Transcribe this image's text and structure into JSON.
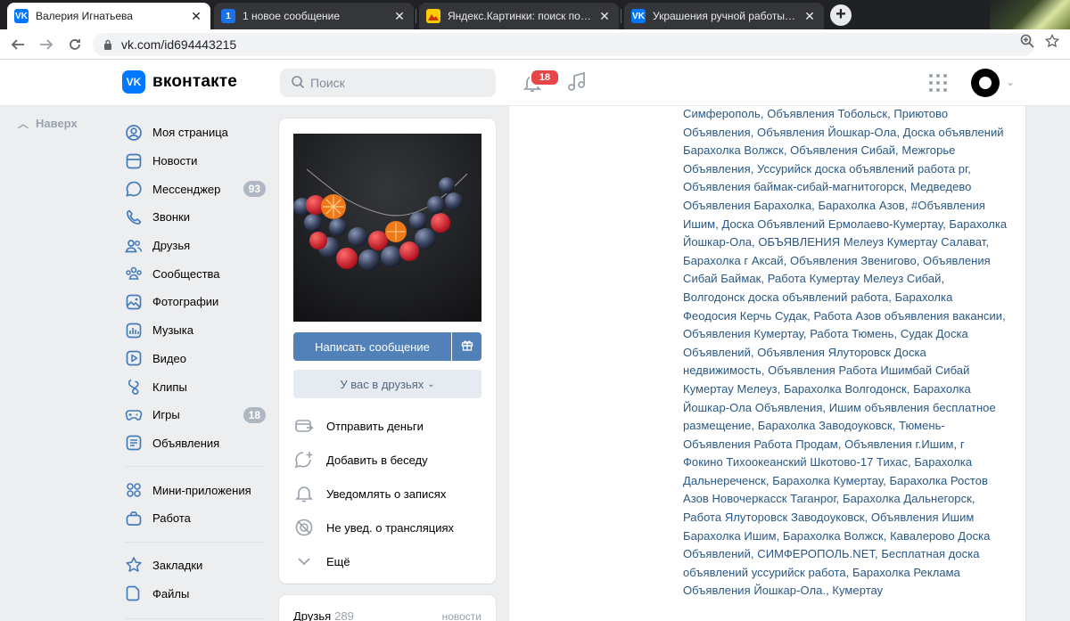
{
  "browser": {
    "tabs": [
      {
        "title": "Валерия Игнатьева",
        "favicon": "vk-icon",
        "active": true
      },
      {
        "title": "1 новое сообщение",
        "favicon": "notification-1-icon",
        "active": false
      },
      {
        "title": "Яндекс.Картинки: поиск по изоб",
        "favicon": "yandex-images-icon",
        "active": false
      },
      {
        "title": "Украшения ручной работы от п",
        "favicon": "vk-icon",
        "active": false
      }
    ],
    "url": "vk.com/id694443215"
  },
  "header": {
    "logo_text": "вконтакте",
    "search_placeholder": "Поиск",
    "notifications_count": "18"
  },
  "nav": {
    "up_label": "Наверх",
    "items": [
      {
        "label": "Моя страница",
        "icon": "user-circle-icon"
      },
      {
        "label": "Новости",
        "icon": "newsfeed-icon"
      },
      {
        "label": "Мессенджер",
        "icon": "message-icon",
        "count": "93"
      },
      {
        "label": "Звонки",
        "icon": "phone-icon"
      },
      {
        "label": "Друзья",
        "icon": "users-icon"
      },
      {
        "label": "Сообщества",
        "icon": "communities-icon"
      },
      {
        "label": "Фотографии",
        "icon": "photo-icon"
      },
      {
        "label": "Музыка",
        "icon": "music-icon"
      },
      {
        "label": "Видео",
        "icon": "video-icon"
      },
      {
        "label": "Клипы",
        "icon": "clips-icon"
      },
      {
        "label": "Игры",
        "icon": "gamepad-icon",
        "count": "18"
      },
      {
        "label": "Объявления",
        "icon": "classifieds-icon"
      }
    ],
    "items2": [
      {
        "label": "Мини-приложения",
        "icon": "apps-icon"
      },
      {
        "label": "Работа",
        "icon": "briefcase-icon"
      }
    ],
    "items3": [
      {
        "label": "Закладки",
        "icon": "star-icon"
      },
      {
        "label": "Файлы",
        "icon": "file-icon"
      }
    ]
  },
  "profile": {
    "write_message": "Написать сообщение",
    "friends_status": "У вас в друзьях",
    "actions": [
      {
        "label": "Отправить деньги",
        "icon": "money-transfer-icon"
      },
      {
        "label": "Добавить в беседу",
        "icon": "add-chat-icon"
      },
      {
        "label": "Уведомлять о записях",
        "icon": "bell-icon"
      },
      {
        "label": "Не увед. о трансляциях",
        "icon": "no-broadcast-icon"
      },
      {
        "label": "Ещё",
        "icon": "chevron-down-icon"
      }
    ],
    "friends_block": {
      "title": "Друзья",
      "count": "289",
      "link": "новости"
    }
  },
  "ads_links": [
    "Симферополь",
    "Объявления Тобольск",
    "Приютово Объявления",
    "Объявления Йошкар-Ола",
    "Доска объявлений Барахолка Волжск",
    "Объявления Сибай",
    "Межгорье Объявления",
    "Уссурийск доска объявлений работа рг",
    "Объявления баймак-сибай-магнитогорск",
    "Медведево Объявления Барахолка",
    "Барахолка Азов",
    "#Объявления Ишим",
    "Доска Объявлений Ермолаево-Кумертау",
    "Барахолка Йошкар-Ола",
    "ОБЪЯВЛЕНИЯ Мелеуз Кумертау Салават",
    "Барахолка г Аксай",
    "Объявления Звенигово",
    "Объявления Сибай Баймак",
    "Работа Кумертау Мелеуз Сибай",
    "Волгодонск доска объявлений работа",
    "Барахолка Феодосия Керчь Судак",
    "Работа Азов объявления вакансии",
    "Объявления Кумертау",
    "Работа Тюмень",
    "Судак Доска Объявлений",
    "Объявления Ялуторовск Доска недвижимость",
    "Объявления Работа Ишимбай Сибай Кумертау Мелеуз",
    "Барахолка Волгодонск",
    "Барахолка Йошкар-Ола Объявления",
    "Ишим объявления бесплатное размещение",
    "Барахолка Заводоуковск",
    "Тюмень-Объявления Работа Продам",
    "Объявления г.Ишим",
    "г Фокино Тихоокеанский Шкотово-17 Тихас",
    "Барахолка Дальнереченск",
    "Барахолка Кумертау",
    "Барахолка Ростов Азов Новочеркасск Таганрог",
    "Барахолка Дальнегорск",
    "Работа Ялуторовск Заводоуковск",
    "Объявления Ишим Барахолка Ишим",
    "Барахолка Волжск",
    "Кавалерово Доска Объявлений",
    "СИМФЕРОПОЛЬ.NET",
    "Бесплатная доска объявлений уссурийск работа",
    "Барахолка Реклама Объявления Йошкар-Ола.",
    "Кумертау"
  ]
}
